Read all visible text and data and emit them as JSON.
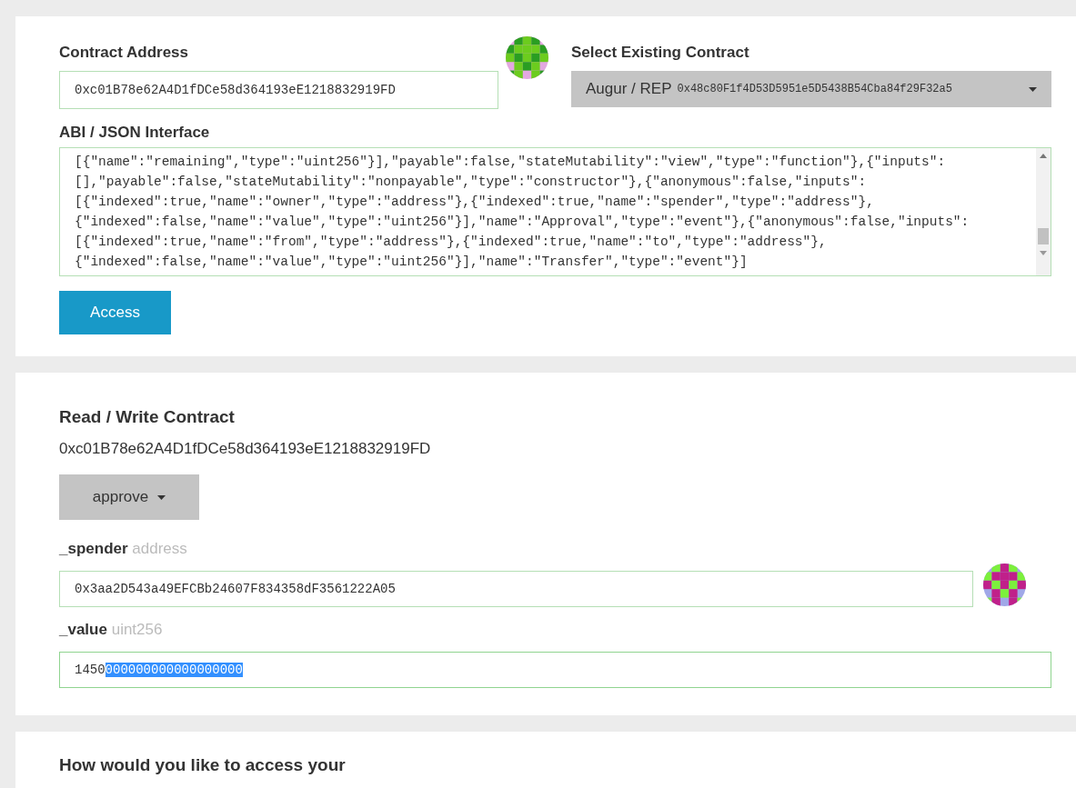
{
  "contract_panel": {
    "address_label": "Contract Address",
    "address_value": "0xc01B78e62A4D1fDCe58d364193eE1218832919FD",
    "select_label": "Select Existing Contract",
    "select_name": "Augur / REP",
    "select_address": "0x48c80F1f4D53D5951e5D5438B54Cba84f29F32a5",
    "abi_label": "ABI / JSON Interface",
    "abi_lines": [
      "[{\"name\":\"remaining\",\"type\":\"uint256\"}],\"payable\":false,\"stateMutability\":\"view\",\"type\":\"function\"},{\"inputs\":",
      "[],\"payable\":false,\"stateMutability\":\"nonpayable\",\"type\":\"constructor\"},{\"anonymous\":false,\"inputs\":",
      "[{\"indexed\":true,\"name\":\"owner\",\"type\":\"address\"},{\"indexed\":true,\"name\":\"spender\",\"type\":\"address\"},",
      "{\"indexed\":false,\"name\":\"value\",\"type\":\"uint256\"}],\"name\":\"Approval\",\"type\":\"event\"},{\"anonymous\":false,\"inputs\":",
      "[{\"indexed\":true,\"name\":\"from\",\"type\":\"address\"},{\"indexed\":true,\"name\":\"to\",\"type\":\"address\"},",
      "{\"indexed\":false,\"name\":\"value\",\"type\":\"uint256\"}],\"name\":\"Transfer\",\"type\":\"event\"}]"
    ],
    "access_button": "Access"
  },
  "read_write_panel": {
    "title": "Read / Write Contract",
    "address": "0xc01B78e62A4D1fDCe58d364193eE1218832919FD",
    "function_select": "approve",
    "params": [
      {
        "name": "_spender",
        "type": "address",
        "identicon": true,
        "value_parts": [
          {
            "text": "0x3aa2D543a49EFCBb24607F834358dF3561222A05",
            "selected": false
          }
        ]
      },
      {
        "name": "_value",
        "type": "uint256",
        "identicon": false,
        "value_parts": [
          {
            "text": "1450",
            "selected": false
          },
          {
            "text": "000000000000000000",
            "selected": true
          }
        ]
      }
    ]
  },
  "access_panel": {
    "title": "How would you like to access your"
  }
}
